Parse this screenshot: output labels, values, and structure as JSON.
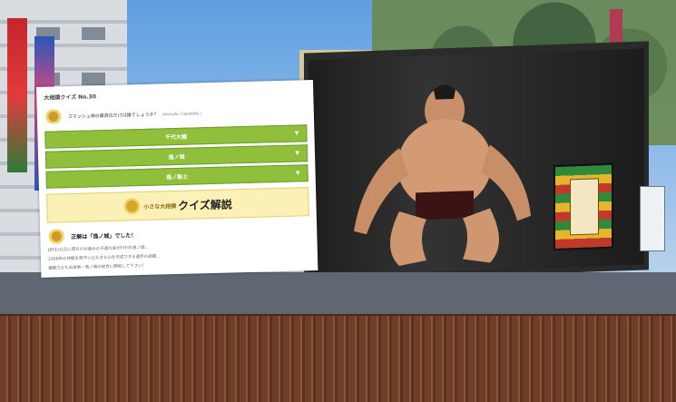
{
  "quiz": {
    "title": "大相撲クイズ No.30",
    "question": "スマッシュ海の最高位だけは誰でしょうか？",
    "question_note": "(VisionAI / CopilotNo.)",
    "options": [
      {
        "label": "千代大龍"
      },
      {
        "label": "逸ノ城"
      },
      {
        "label": "逸ノ聡士"
      }
    ],
    "explanation_small": "小さな大相撲",
    "explanation_label": "クイズ解説",
    "answer_text": "正解は「逸ノ城」でした！",
    "body_lines": [
      "(訳注)元旦に両方の仕組みの予選大会が行われ逸ノ城…",
      "2008年の仲間を見守らせ大きな山を作成できる選手の話題…",
      "優勝力士も出身地・逸ノ城の総合に関係して下さい！"
    ]
  },
  "colors": {
    "option_green": "#8fbf3b",
    "explain_yellow": "#fbf1b7",
    "fence_brown": "#6e3f28"
  }
}
